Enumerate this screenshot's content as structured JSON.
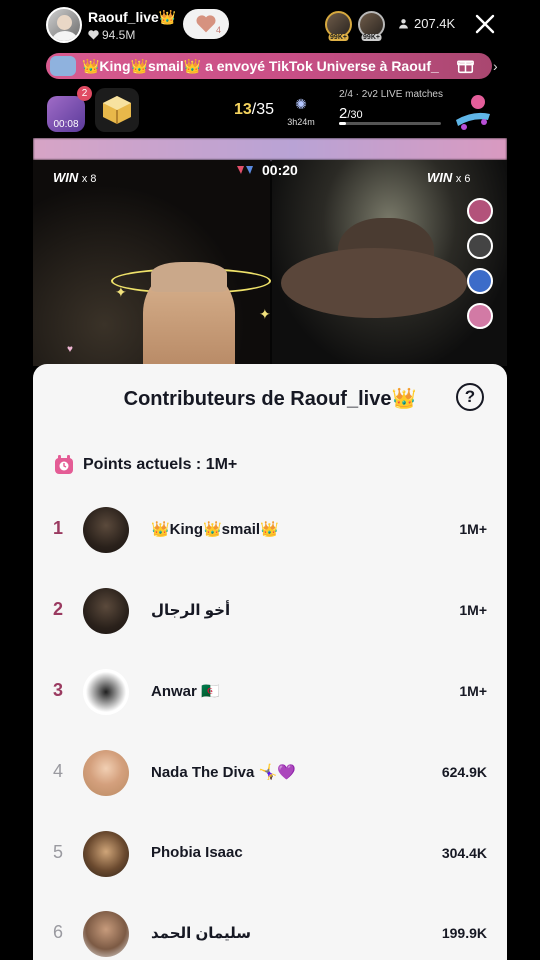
{
  "header": {
    "host_name": "Raouf_live👑",
    "host_likes": "94.5M",
    "follow_count": "4",
    "viewer_badge_1": "99K+",
    "viewer_badge_2": "99K+",
    "viewers_count": "207.4K"
  },
  "gift_banner": {
    "text": "👑King👑smail👑 a envoyé TikTok Universe à Raouf_"
  },
  "match": {
    "badge_number": "2",
    "badge_timer": "00:08",
    "score_current": "13",
    "score_total": "/35",
    "timer_label": "3h24m",
    "matches_label": "2/4 · 2v2 LIVE matches",
    "matches_current": "2",
    "matches_total": "/30",
    "matches_progress": 0.067
  },
  "video": {
    "win_left_label": "WIN",
    "win_left_count": "x 8",
    "win_right_label": "WIN",
    "win_right_count": "x 6",
    "battle_timer": "00:20"
  },
  "panel": {
    "title": "Contributeurs de Raouf_live👑",
    "help": "?",
    "points_label": "Points actuels : 1M+",
    "contributors": [
      {
        "rank": "1",
        "name": "👑King👑smail👑",
        "value": "1M+"
      },
      {
        "rank": "2",
        "name": "أخو الرجال",
        "value": "1M+"
      },
      {
        "rank": "3",
        "name": "Anwar 🇩🇿",
        "value": "1M+"
      },
      {
        "rank": "4",
        "name": "Nada The Diva 🤸‍♀️💜",
        "value": "624.9K"
      },
      {
        "rank": "5",
        "name": "Phobia Isaac",
        "value": "304.4K"
      },
      {
        "rank": "6",
        "name": "سليمان الحمد",
        "value": "199.9K"
      }
    ]
  },
  "colors": {
    "banner": "#c84f86",
    "rank_top": "#9a3a60",
    "panel_bg": "#f6f6f6",
    "score_highlight": "#f4d35e"
  },
  "icons": [
    "heart-icon",
    "viewers-icon",
    "close-icon",
    "gift-icon",
    "chevron-right-icon",
    "help-icon",
    "points-icon",
    "versus-icon",
    "firework-icon"
  ]
}
